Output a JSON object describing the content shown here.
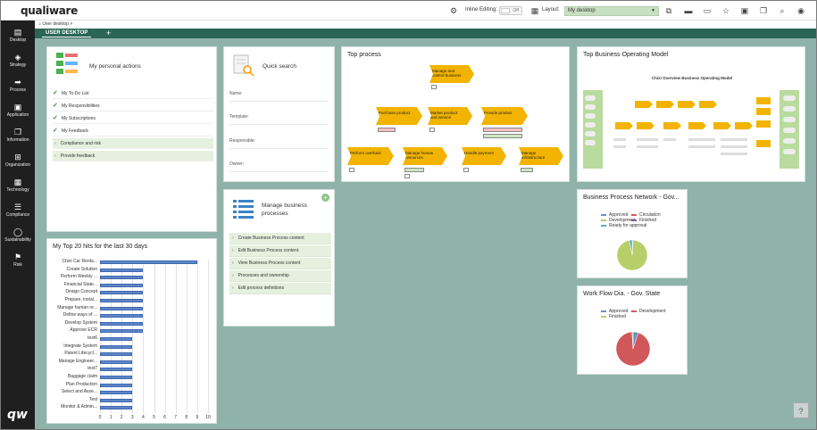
{
  "app": {
    "logo": "qualiware",
    "logo_mark": "qw"
  },
  "toolbar": {
    "inline_editing_label": "Inline Editing:",
    "inline_editing_state": "Off",
    "layout_label": "Layout:",
    "layout_value": "My desktop"
  },
  "breadcrumb": {
    "item": "User desktop",
    "separator": ">"
  },
  "tabs": {
    "active": "USER DESKTOP",
    "add": "+"
  },
  "nav": {
    "items": [
      {
        "label": "Desktop",
        "icon": "desktop-icon"
      },
      {
        "label": "Strategy",
        "icon": "strategy-icon"
      },
      {
        "label": "Process",
        "icon": "process-icon"
      },
      {
        "label": "Application",
        "icon": "application-icon"
      },
      {
        "label": "Information",
        "icon": "information-icon"
      },
      {
        "label": "Organization",
        "icon": "organization-icon"
      },
      {
        "label": "Technology",
        "icon": "technology-icon"
      },
      {
        "label": "Compliance",
        "icon": "compliance-icon"
      },
      {
        "label": "Sustainability",
        "icon": "sustainability-icon"
      },
      {
        "label": "Risk",
        "icon": "risk-icon"
      }
    ]
  },
  "personal_actions": {
    "title": "My personal actions",
    "items": [
      {
        "label": "My To-Do List"
      },
      {
        "label": "My Responsibilities"
      },
      {
        "label": "My Subscriptions"
      },
      {
        "label": "My Feedback"
      }
    ],
    "expandables": [
      {
        "label": "Compliance and risk"
      },
      {
        "label": "Provide feedback"
      }
    ]
  },
  "quick_search": {
    "title": "Quick search",
    "fields": [
      "Name:",
      "Template:",
      "Responsible:",
      "Owner:"
    ]
  },
  "manage_bp": {
    "title_line1": "Manage business",
    "title_line2": "processes",
    "add_icon": "+",
    "items": [
      "Create Business Process content",
      "Edit Business Process content",
      "View Business Process content",
      "Processes and ownership",
      "Edit process definitions"
    ]
  },
  "top_process": {
    "title": "Top process",
    "boxes": [
      {
        "line1": "Manage and",
        "line2": "control business"
      },
      {
        "line1": "Purchase product",
        "line2": ""
      },
      {
        "line1": "Market product",
        "line2": "and service"
      },
      {
        "line1": "Provide product",
        "line2": ""
      },
      {
        "line1": "Perform overhaul",
        "line2": ""
      },
      {
        "line1": "Manage human",
        "line2": "resources"
      },
      {
        "line1": "Handle payment",
        "line2": ""
      },
      {
        "line1": "Manage",
        "line2": "infrastructure"
      }
    ]
  },
  "top_bom": {
    "title": "Top Business Operating Model",
    "diagram_title": "Chixi Overview Business Operating Model"
  },
  "bp_network": {
    "title": "Business Process Network - Gov...",
    "legend": [
      {
        "label": "Approved",
        "color": "#6a8fcf"
      },
      {
        "label": "Circulation",
        "color": "#d0585a"
      },
      {
        "label": "Development",
        "color": "#b7cf69"
      },
      {
        "label": "Finished",
        "color": "#7d5fa6"
      },
      {
        "label": "Ready for approval",
        "color": "#4fb0c8"
      }
    ]
  },
  "workflow": {
    "title": "Work Flow Dia. - Gov. State",
    "legend": [
      {
        "label": "Approved",
        "color": "#6a8fcf"
      },
      {
        "label": "Development",
        "color": "#d0585a"
      },
      {
        "label": "Finished",
        "color": "#b7cf69"
      }
    ]
  },
  "top_hits": {
    "title": "My Top 20 hits for the last 30 days"
  },
  "chart_data": [
    {
      "type": "bar",
      "orientation": "horizontal",
      "categories": [
        "Chixi Car Renta...",
        "Create Solution",
        "Perform Weekly ...",
        "Financial State...",
        "Design Concept",
        "Prepare, instal...",
        "Manage human re...",
        "Define ways of ...",
        "Develop System",
        "Approve ECR",
        "test6",
        "Integrate System",
        "Patent Lifecycl...",
        "Manage Engineer...",
        "test7",
        "Baggage claim",
        "Plan Production",
        "Select and Asse...",
        "Test",
        "Monitor & Admin..."
      ],
      "values": [
        9,
        4,
        4,
        4,
        4,
        4,
        4,
        4,
        4,
        4,
        3,
        3,
        3,
        3,
        3,
        3,
        3,
        3,
        3,
        3
      ],
      "title": "My Top 20 hits for the last 30 days",
      "xlim": [
        0,
        10
      ],
      "xticks": [
        "0",
        "1",
        "2",
        "3",
        "4",
        "5",
        "6",
        "7",
        "8",
        "9",
        "10"
      ],
      "grid": true
    },
    {
      "type": "pie",
      "title": "Business Process Network - Gov...",
      "labels": [
        "Approved",
        "Circulation",
        "Development",
        "Finished",
        "Ready for approval"
      ],
      "values": [
        1,
        0,
        96,
        0,
        3
      ]
    },
    {
      "type": "pie",
      "title": "Work Flow Dia. - Gov. State",
      "labels": [
        "Approved",
        "Development",
        "Finished"
      ],
      "values": [
        5,
        94,
        1
      ]
    }
  ],
  "help": {
    "label": "?"
  }
}
